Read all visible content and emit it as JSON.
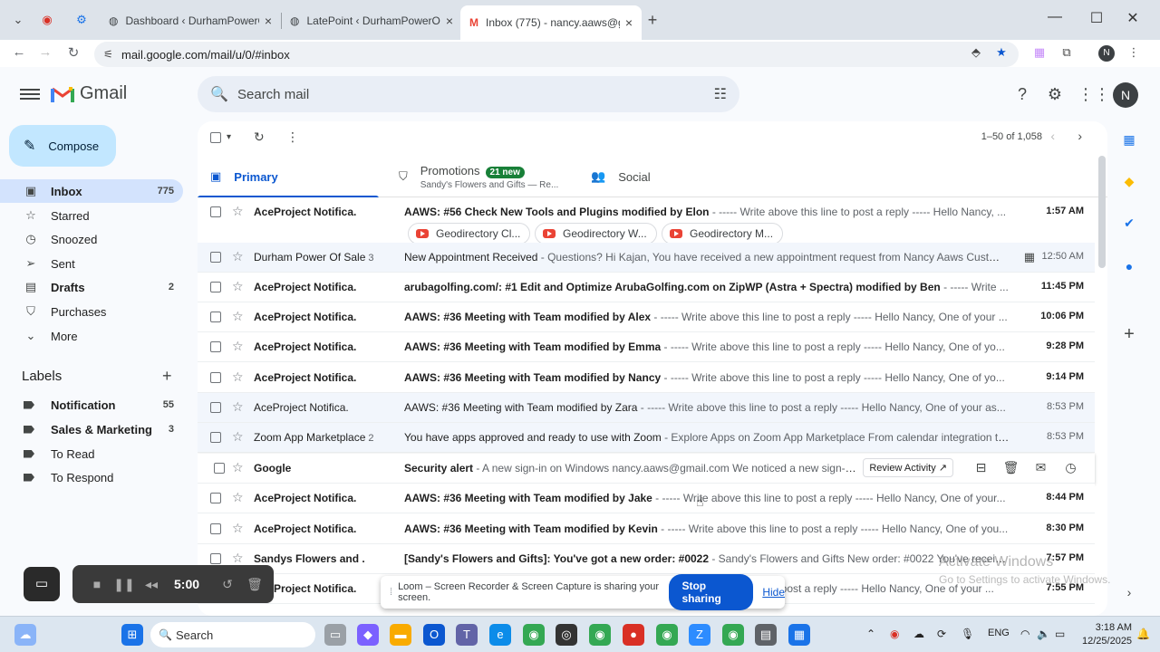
{
  "browser": {
    "tabs": [
      {
        "title": "Dashboard ‹ DurhamPowerOfS..."
      },
      {
        "title": "LatePoint ‹ DurhamPowerOfSal..."
      },
      {
        "title": "Inbox (775) - nancy.aaws@gma..."
      }
    ],
    "url": "mail.google.com/mail/u/0/#inbox",
    "profile_initial": "N"
  },
  "header": {
    "app_name": "Gmail",
    "search_placeholder": "Search mail",
    "avatar_initial": "N"
  },
  "nav": {
    "compose_label": "Compose",
    "items": [
      {
        "label": "Inbox",
        "count": "775",
        "icon": "inbox-icon"
      },
      {
        "label": "Starred",
        "count": "",
        "icon": "star-icon"
      },
      {
        "label": "Snoozed",
        "count": "",
        "icon": "clock-icon"
      },
      {
        "label": "Sent",
        "count": "",
        "icon": "send-icon"
      },
      {
        "label": "Drafts",
        "count": "2",
        "icon": "draft-icon"
      },
      {
        "label": "Purchases",
        "count": "",
        "icon": "purchases-icon"
      },
      {
        "label": "More",
        "count": "",
        "icon": "chevron-down-icon"
      }
    ],
    "labels_title": "Labels",
    "labels": [
      {
        "label": "Notification",
        "count": "55"
      },
      {
        "label": "Sales & Marketing",
        "count": "3"
      },
      {
        "label": "To Read",
        "count": ""
      },
      {
        "label": "To Respond",
        "count": ""
      }
    ]
  },
  "toolbar": {
    "pager": "1–50 of 1,058"
  },
  "category_tabs": {
    "primary": "Primary",
    "promotions": "Promotions",
    "promotions_badge": "21 new",
    "promotions_sub": "Sandy's Flowers and Gifts — Re...",
    "social": "Social"
  },
  "emails": [
    {
      "sender": "AceProject Notifica.",
      "count": "",
      "subject": "AAWS: #56 Check New Tools and Plugins modified by Elon",
      "snippet": " - ----- Write above this line to post a reply ----- Hello Nancy, ...",
      "time": "1:57 AM",
      "unread": true
    },
    {
      "sender": "Durham Power Of Sale",
      "count": "3",
      "subject": "New Appointment Received",
      "snippet": " - Questions? Hi Kajan, You have received a new appointment request from Nancy Aaws Customer...",
      "time": "12:50 AM",
      "unread": false
    },
    {
      "sender": "AceProject Notifica.",
      "count": "",
      "subject": "arubagolfing.com/: #1 Edit and Optimize ArubaGolfing.com on ZipWP (Astra + Spectra) modified by Ben",
      "snippet": " - ----- Write ...",
      "time": "11:45 PM",
      "unread": true
    },
    {
      "sender": "AceProject Notifica.",
      "count": "",
      "subject": "AAWS: #36 Meeting with Team modified by Alex",
      "snippet": " - ----- Write above this line to post a reply ----- Hello Nancy, One of your ...",
      "time": "10:06 PM",
      "unread": true
    },
    {
      "sender": "AceProject Notifica.",
      "count": "",
      "subject": "AAWS: #36 Meeting with Team modified by Emma",
      "snippet": " - ----- Write above this line to post a reply ----- Hello Nancy, One of yo...",
      "time": "9:28 PM",
      "unread": true
    },
    {
      "sender": "AceProject Notifica.",
      "count": "",
      "subject": "AAWS: #36 Meeting with Team modified by Nancy",
      "snippet": " - ----- Write above this line to post a reply ----- Hello Nancy, One of yo...",
      "time": "9:14 PM",
      "unread": true
    },
    {
      "sender": "AceProject Notifica.",
      "count": "",
      "subject": "AAWS: #36 Meeting with Team modified by Zara",
      "snippet": " - ----- Write above this line to post a reply ----- Hello Nancy, One of your as...",
      "time": "8:53 PM",
      "unread": false
    },
    {
      "sender": "Zoom App Marketplace",
      "count": "2",
      "subject": "You have apps approved and ready to use with Zoom",
      "snippet": " - Explore Apps on Zoom App Marketplace From calendar integration to ...",
      "time": "8:53 PM",
      "unread": false
    },
    {
      "sender": "Google",
      "count": "",
      "subject": "Security alert",
      "snippet": " - A new sign-in on Windows nancy.aaws@gmail.com We noticed a new sign-in t...",
      "time": "",
      "unread": true
    },
    {
      "sender": "AceProject Notifica.",
      "count": "",
      "subject": "AAWS: #36 Meeting with Team modified by Jake",
      "snippet": " - ----- Write above this line to post a reply ----- Hello Nancy, One of your...",
      "time": "8:44 PM",
      "unread": true
    },
    {
      "sender": "AceProject Notifica.",
      "count": "",
      "subject": "AAWS: #36 Meeting with Team modified by Kevin",
      "snippet": " - ----- Write above this line to post a reply ----- Hello Nancy, One of you...",
      "time": "8:30 PM",
      "unread": true
    },
    {
      "sender": "Sandys Flowers and .",
      "count": "",
      "subject": "[Sandy's Flowers and Gifts]: You've got a new order: #0022",
      "snippet": " - Sandy's Flowers and Gifts New order: #0022 You've receive...",
      "time": "7:57 PM",
      "unread": true
    },
    {
      "sender": "AceProject Notifica.",
      "count": "",
      "subject": "AAWS: #36 Meeting with Team modified by ...",
      "snippet": " - ----- Write above this line to post a reply ----- Hello Nancy, One of your ...",
      "time": "7:55 PM",
      "unread": true
    }
  ],
  "attachments": [
    "Geodirectory Cl...",
    "Geodirectory W...",
    "Geodirectory M..."
  ],
  "row_actions": {
    "review": "Review Activity ↗"
  },
  "loom": {
    "timer": "5:00",
    "share_text": "Loom – Screen Recorder & Screen Capture is sharing your screen.",
    "stop_label": "Stop sharing",
    "hide_label": "Hide"
  },
  "watermark": {
    "line1": "Activate Windows",
    "line2": "Go to Settings to activate Windows."
  },
  "taskbar": {
    "search_label": "Search",
    "lang": "ENG",
    "time": "3:18 AM",
    "date": "12/25/2025"
  }
}
